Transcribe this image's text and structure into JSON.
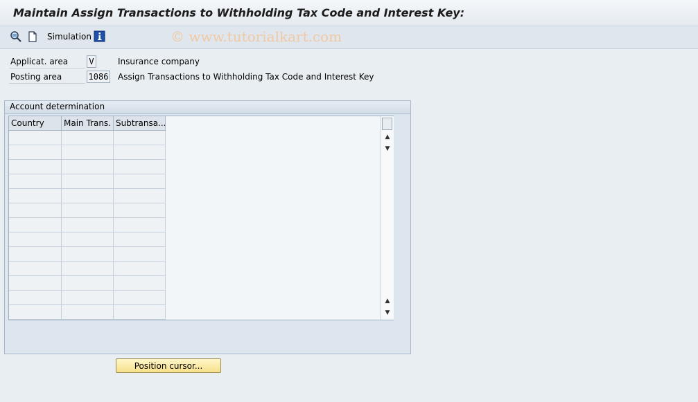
{
  "title": "Maintain Assign Transactions to Withholding Tax Code and Interest Key:",
  "toolbar": {
    "icons": [
      "change-display-icon",
      "new-document-icon",
      "info-icon"
    ],
    "simulation_label": "Simulation",
    "watermark": "© www.tutorialkart.com"
  },
  "fields": {
    "applicat_area": {
      "label": "Applicat. area",
      "value": "V",
      "description": "Insurance company"
    },
    "posting_area": {
      "label": "Posting area",
      "value": "1086",
      "description": "Assign Transactions to Withholding Tax Code and Interest Key"
    }
  },
  "group": {
    "title": "Account determination",
    "columns": [
      "Country",
      "Main Trans.",
      "Subtransa..."
    ],
    "rows": [
      [
        "",
        "",
        ""
      ],
      [
        "",
        "",
        ""
      ],
      [
        "",
        "",
        ""
      ],
      [
        "",
        "",
        ""
      ],
      [
        "",
        "",
        ""
      ],
      [
        "",
        "",
        ""
      ],
      [
        "",
        "",
        ""
      ],
      [
        "",
        "",
        ""
      ],
      [
        "",
        "",
        ""
      ],
      [
        "",
        "",
        ""
      ],
      [
        "",
        "",
        ""
      ],
      [
        "",
        "",
        ""
      ],
      [
        "",
        "",
        ""
      ]
    ]
  },
  "buttons": {
    "position_cursor": "Position cursor..."
  },
  "colors": {
    "background": "#e9eef3",
    "button_yellow": "#f6e08a",
    "info_blue": "#1f4fa8"
  }
}
